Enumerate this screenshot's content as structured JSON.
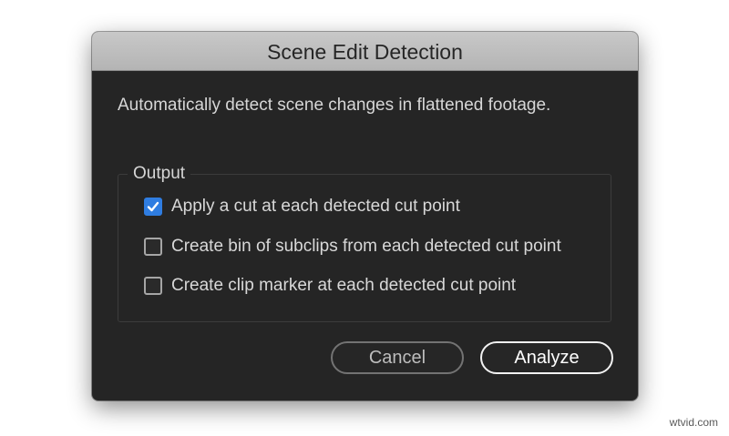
{
  "dialog": {
    "title": "Scene Edit Detection",
    "description": "Automatically detect scene changes in flattened footage.",
    "output": {
      "legend": "Output",
      "options": [
        {
          "label": "Apply a cut at each detected cut point",
          "checked": true
        },
        {
          "label": "Create bin of subclips from each detected cut point",
          "checked": false
        },
        {
          "label": "Create clip marker at each detected cut point",
          "checked": false
        }
      ]
    },
    "buttons": {
      "cancel": "Cancel",
      "analyze": "Analyze"
    }
  },
  "watermark": "wtvid.com",
  "colors": {
    "dialog_background": "#252525",
    "titlebar": "#bdbdbd",
    "checkbox_checked": "#2f7de1"
  },
  "icons": {
    "checkmark": "check-icon"
  }
}
